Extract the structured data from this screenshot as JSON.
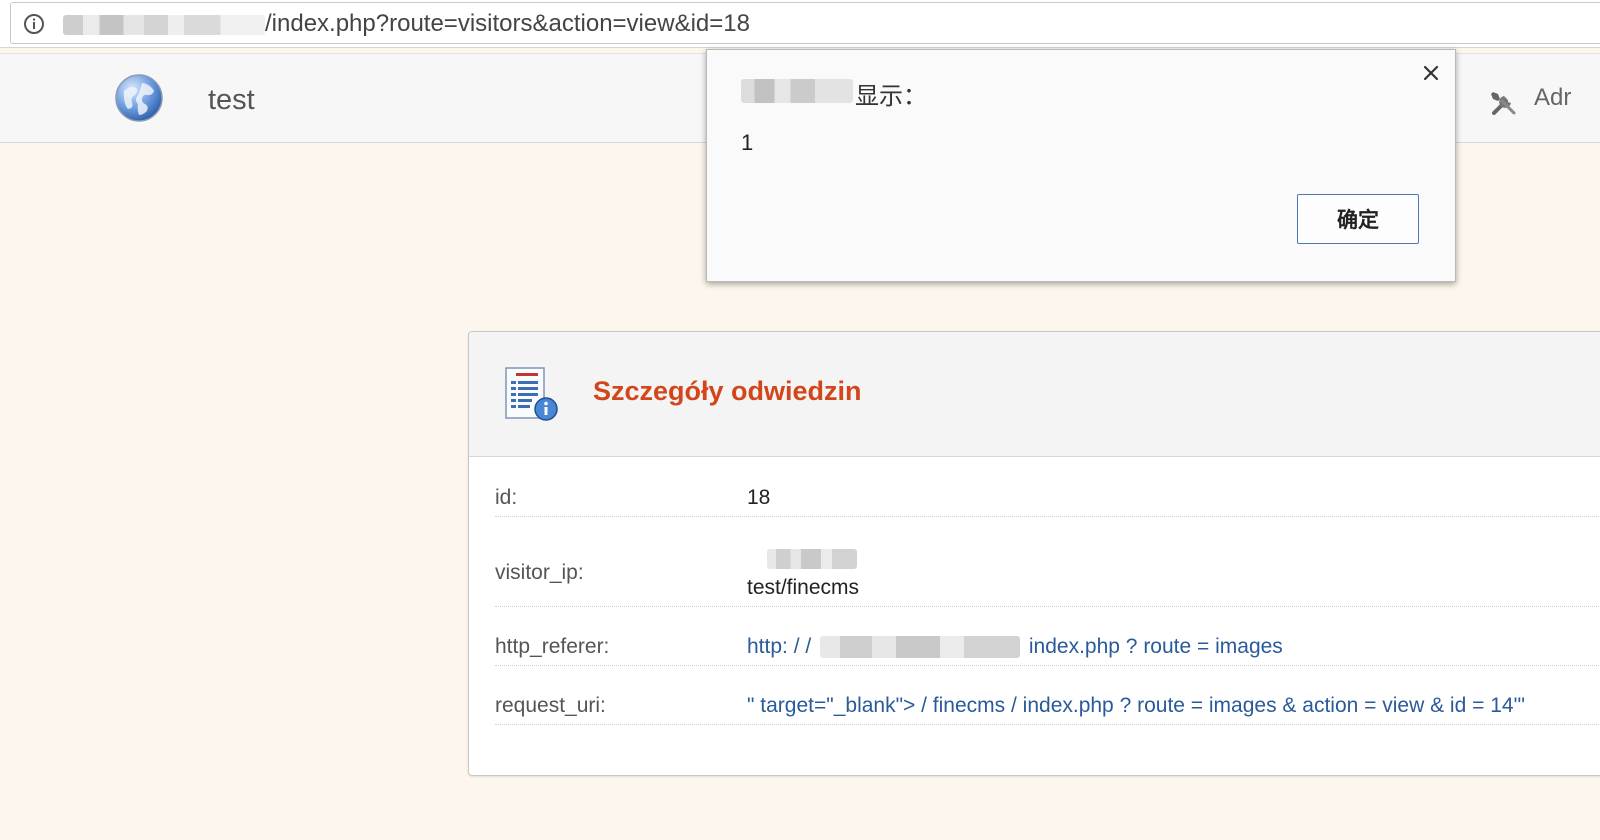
{
  "browser": {
    "url_visible": "/index.php?route=visitors&action=view&id=18"
  },
  "header": {
    "site_title": "test",
    "admin_label": "Adr"
  },
  "dialog": {
    "title_suffix": "显示：",
    "message": "1",
    "ok_label": "确定"
  },
  "panel": {
    "title": "Szczegóły odwiedzin",
    "rows": [
      {
        "label": "id:",
        "value": "18"
      },
      {
        "label": "visitor_ip:",
        "value": "test/finecms"
      },
      {
        "label": "http_referer:",
        "value_prefix": "http: / /",
        "value_suffix": "index.php ? route = images"
      },
      {
        "label": "request_uri:",
        "value": "\" target=\"_blank\"> / finecms / index.php ? route = images & action = view & id = 14'\""
      }
    ]
  },
  "colors": {
    "title_accent": "#d2461c",
    "link": "#2a5a9a",
    "background": "#fdf6ec"
  }
}
